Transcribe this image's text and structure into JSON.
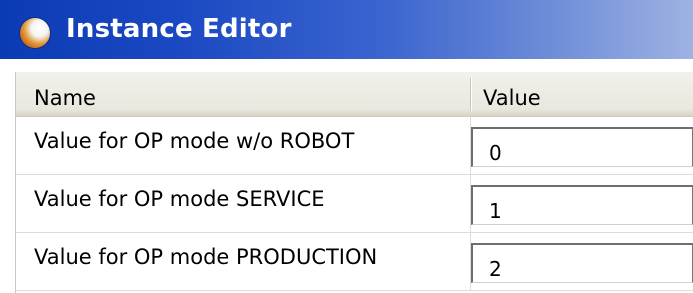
{
  "window": {
    "title": "Instance Editor",
    "icon": "app-orb-icon"
  },
  "table": {
    "columns": [
      "Name",
      "Value"
    ],
    "rows": [
      {
        "name": "Value for OP mode w/o ROBOT",
        "value": "0"
      },
      {
        "name": "Value for OP mode SERVICE",
        "value": "1"
      },
      {
        "name": "Value for OP mode PRODUCTION",
        "value": "2"
      }
    ]
  },
  "colors": {
    "titlebar_start": "#0b3bb4",
    "titlebar_end": "#9eb2e3",
    "header_bg": "#ece9d8"
  }
}
